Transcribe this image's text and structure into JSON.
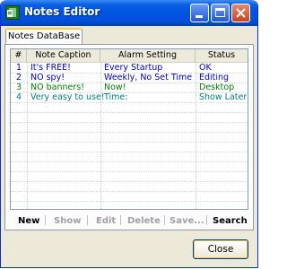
{
  "window": {
    "title": "Notes Editor"
  },
  "tabs": [
    {
      "label": "Notes DataBase"
    }
  ],
  "table": {
    "columns": [
      "#",
      "Note Caption",
      "Alarm Setting",
      "Status"
    ],
    "rows": [
      {
        "num": "1",
        "caption": "It's FREE!",
        "alarm": "Every Startup",
        "status": "OK",
        "color": "#0000c0"
      },
      {
        "num": "2",
        "caption": "NO spy!",
        "alarm": "Weekly, No Set Time",
        "status": "Editing",
        "color": "#0000c0"
      },
      {
        "num": "3",
        "caption": "NO banners!",
        "alarm": "Now!",
        "status": "Desktop",
        "color": "#008000"
      },
      {
        "num": "4",
        "caption": "Very easy to use!",
        "alarm": "Time:",
        "status": "Show Later",
        "color": "#008080"
      }
    ]
  },
  "toolbar": {
    "new": "New",
    "show": "Show",
    "edit": "Edit",
    "delete": "Delete",
    "save": "Save...",
    "search": "Search"
  },
  "footer": {
    "close": "Close"
  },
  "colors": {
    "enabled": "#000000",
    "disabled": "#a0a0a0"
  }
}
